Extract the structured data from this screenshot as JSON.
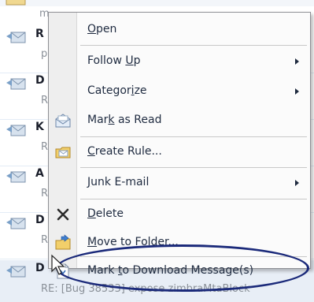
{
  "message_list": {
    "top_subject_fragment": "m",
    "rows": [
      {
        "sender_initial": "R",
        "subject_initial": "p"
      },
      {
        "sender_initial": "D",
        "subject_initial": "R"
      },
      {
        "sender_initial": "K",
        "subject_initial": "R"
      },
      {
        "sender_initial": "A",
        "subject_initial": "R"
      },
      {
        "sender_initial": "D",
        "subject_initial": "R"
      }
    ],
    "selected_row": {
      "sender_initial": "D",
      "subject": "RE: [Bug 38533] expose zimbraMtaBlock"
    }
  },
  "context_menu": {
    "items": [
      {
        "label_pre": "",
        "label_key": "O",
        "label_post": "pen",
        "icon": "none",
        "submenu": false
      },
      {
        "label_pre": "Follow ",
        "label_key": "U",
        "label_post": "p",
        "icon": "none",
        "submenu": true
      },
      {
        "label_pre": "Categor",
        "label_key": "i",
        "label_post": "ze",
        "icon": "none",
        "submenu": true
      },
      {
        "label_pre": "Mar",
        "label_key": "k",
        "label_post": " as Read",
        "icon": "open-envelope-icon",
        "submenu": false
      },
      {
        "label_pre": "",
        "label_key": "C",
        "label_post": "reate Rule...",
        "icon": "create-rule-icon",
        "submenu": false
      },
      {
        "label_pre": "",
        "label_key": "J",
        "label_post": "unk E-mail",
        "icon": "none",
        "submenu": true
      },
      {
        "label_pre": "",
        "label_key": "D",
        "label_post": "elete",
        "icon": "delete-x-icon",
        "submenu": false
      },
      {
        "label_pre": "",
        "label_key": "M",
        "label_post": "ove to Folder...",
        "icon": "move-to-folder-icon",
        "submenu": false
      },
      {
        "label_pre": "Mark ",
        "label_key": "t",
        "label_post": "o Download Message(s)",
        "icon": "download-message-icon",
        "submenu": false
      }
    ]
  },
  "colors": {
    "annotation_ellipse": "#1b2a7a",
    "menu_gutter": "#eeeeee",
    "menu_background": "#fbfbfb"
  }
}
